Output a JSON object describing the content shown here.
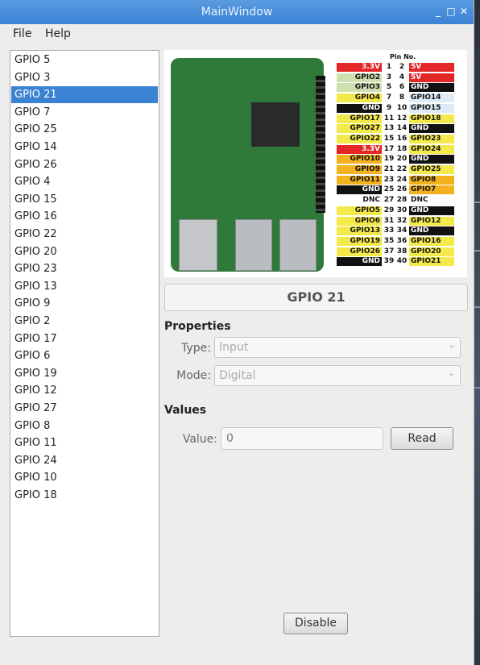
{
  "window": {
    "title": "MainWindow"
  },
  "menubar": {
    "items": [
      "File",
      "Help"
    ]
  },
  "gpio_list": {
    "items": [
      "GPIO 5",
      "GPIO 3",
      "GPIO 21",
      "GPIO 7",
      "GPIO 25",
      "GPIO 14",
      "GPIO 26",
      "GPIO 4",
      "GPIO 15",
      "GPIO 16",
      "GPIO 22",
      "GPIO 20",
      "GPIO 23",
      "GPIO 13",
      "GPIO 9",
      "GPIO 2",
      "GPIO 17",
      "GPIO 6",
      "GPIO 19",
      "GPIO 12",
      "GPIO 27",
      "GPIO 8",
      "GPIO 11",
      "GPIO 24",
      "GPIO 10",
      "GPIO 18"
    ],
    "selected": "GPIO 21"
  },
  "pinout": {
    "header": "Pin No.",
    "rows": [
      {
        "l": "3.3V",
        "lc": "#e32626",
        "lt": "#fff",
        "a": "1",
        "b": "2",
        "r": "5V",
        "rc": "#e32626",
        "rt": "#fff"
      },
      {
        "l": "GPIO2",
        "lc": "#cfe0b0",
        "lt": "#111",
        "a": "3",
        "b": "4",
        "r": "5V",
        "rc": "#e32626",
        "rt": "#fff"
      },
      {
        "l": "GPIO3",
        "lc": "#cfe0b0",
        "lt": "#111",
        "a": "5",
        "b": "6",
        "r": "GND",
        "rc": "#111",
        "rt": "#fff"
      },
      {
        "l": "GPIO4",
        "lc": "#f4e94a",
        "lt": "#111",
        "a": "7",
        "b": "8",
        "r": "GPIO14",
        "rc": "#dcebf7",
        "rt": "#111"
      },
      {
        "l": "GND",
        "lc": "#111",
        "lt": "#fff",
        "a": "9",
        "b": "10",
        "r": "GPIO15",
        "rc": "#dcebf7",
        "rt": "#111"
      },
      {
        "l": "GPIO17",
        "lc": "#f4e94a",
        "lt": "#111",
        "a": "11",
        "b": "12",
        "r": "GPIO18",
        "rc": "#f4e94a",
        "rt": "#111"
      },
      {
        "l": "GPIO27",
        "lc": "#f4e94a",
        "lt": "#111",
        "a": "13",
        "b": "14",
        "r": "GND",
        "rc": "#111",
        "rt": "#fff"
      },
      {
        "l": "GPIO22",
        "lc": "#f4e94a",
        "lt": "#111",
        "a": "15",
        "b": "16",
        "r": "GPIO23",
        "rc": "#f4e94a",
        "rt": "#111"
      },
      {
        "l": "3.3V",
        "lc": "#e32626",
        "lt": "#fff",
        "a": "17",
        "b": "18",
        "r": "GPIO24",
        "rc": "#f4e94a",
        "rt": "#111"
      },
      {
        "l": "GPIO10",
        "lc": "#f2b21d",
        "lt": "#111",
        "a": "19",
        "b": "20",
        "r": "GND",
        "rc": "#111",
        "rt": "#fff"
      },
      {
        "l": "GPIO9",
        "lc": "#f2b21d",
        "lt": "#111",
        "a": "21",
        "b": "22",
        "r": "GPIO25",
        "rc": "#f4e94a",
        "rt": "#111"
      },
      {
        "l": "GPIO11",
        "lc": "#f2b21d",
        "lt": "#111",
        "a": "23",
        "b": "24",
        "r": "GPIO8",
        "rc": "#f2b21d",
        "rt": "#111"
      },
      {
        "l": "GND",
        "lc": "#111",
        "lt": "#fff",
        "a": "25",
        "b": "26",
        "r": "GPIO7",
        "rc": "#f2b21d",
        "rt": "#111"
      },
      {
        "l": "DNC",
        "lc": "#ffffff",
        "lt": "#111",
        "a": "27",
        "b": "28",
        "r": "DNC",
        "rc": "#ffffff",
        "rt": "#111"
      },
      {
        "l": "GPIO5",
        "lc": "#f4e94a",
        "lt": "#111",
        "a": "29",
        "b": "30",
        "r": "GND",
        "rc": "#111",
        "rt": "#fff"
      },
      {
        "l": "GPIO6",
        "lc": "#f4e94a",
        "lt": "#111",
        "a": "31",
        "b": "32",
        "r": "GPIO12",
        "rc": "#f4e94a",
        "rt": "#111"
      },
      {
        "l": "GPIO13",
        "lc": "#f4e94a",
        "lt": "#111",
        "a": "33",
        "b": "34",
        "r": "GND",
        "rc": "#111",
        "rt": "#fff"
      },
      {
        "l": "GPIO19",
        "lc": "#f4e94a",
        "lt": "#111",
        "a": "35",
        "b": "36",
        "r": "GPIO16",
        "rc": "#f4e94a",
        "rt": "#111"
      },
      {
        "l": "GPIO26",
        "lc": "#f4e94a",
        "lt": "#111",
        "a": "37",
        "b": "38",
        "r": "GPIO20",
        "rc": "#f4e94a",
        "rt": "#111"
      },
      {
        "l": "GND",
        "lc": "#111",
        "lt": "#fff",
        "a": "39",
        "b": "40",
        "r": "GPIO21",
        "rc": "#f4e94a",
        "rt": "#111"
      }
    ]
  },
  "pin_label": "GPIO 21",
  "properties": {
    "heading": "Properties",
    "type_label": "Type:",
    "type_value": "Input",
    "mode_label": "Mode:",
    "mode_value": "Digital"
  },
  "values": {
    "heading": "Values",
    "value_label": "Value:",
    "value_placeholder": "0",
    "read_button": "Read"
  },
  "disable_button": "Disable",
  "colors": {
    "accent": "#3b82d4"
  }
}
